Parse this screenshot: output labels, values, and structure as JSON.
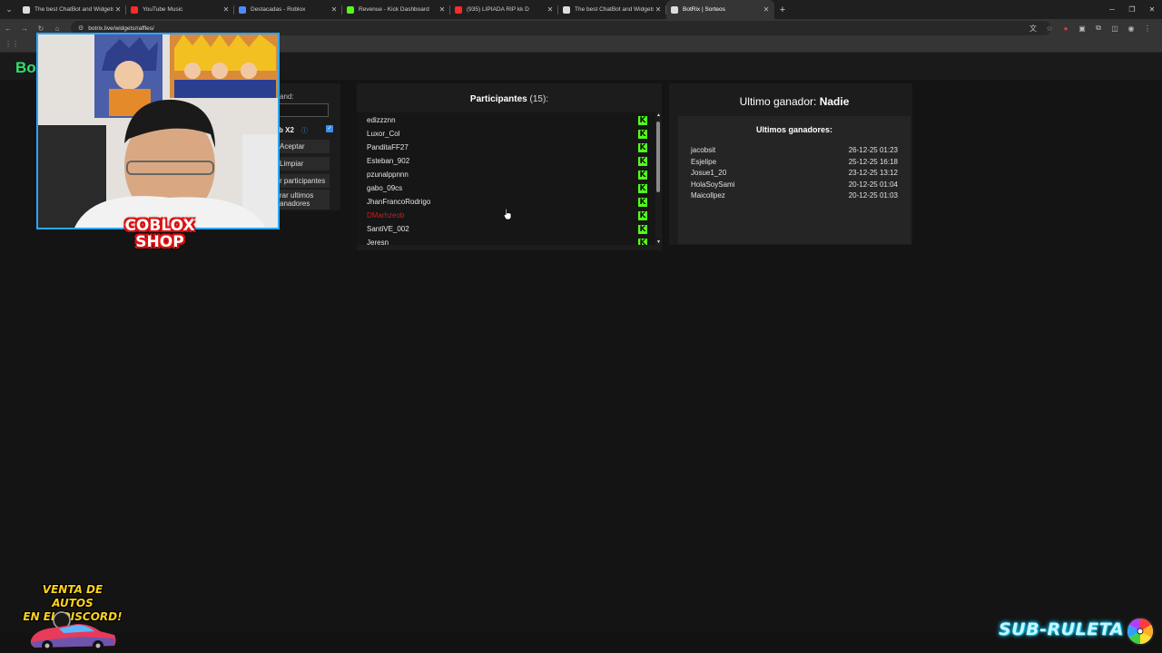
{
  "browser": {
    "tabs": [
      {
        "title": "The best ChatBot and Widgets",
        "fav_color": "#dddddd",
        "active": false
      },
      {
        "title": "YouTube Music",
        "fav_color": "#ff2a2a",
        "active": false
      },
      {
        "title": "Destacadas - Roblox",
        "fav_color": "#4a8cff",
        "active": false
      },
      {
        "title": "Revenue - Kick Dashboard",
        "fav_color": "#53fc18",
        "active": false
      },
      {
        "title": "(935) LIPIADA RIP kk D",
        "fav_color": "#ff2a2a",
        "active": false
      },
      {
        "title": "The best ChatBot and Widgets",
        "fav_color": "#dddddd",
        "active": false
      },
      {
        "title": "BotRix | Sorteos",
        "fav_color": "#dddddd",
        "active": true
      }
    ],
    "url": "botrix.live/widgets/raffles/"
  },
  "page": {
    "brand": "Bot",
    "left_panel": {
      "label_partial": "and:",
      "x2_label": "b X2",
      "accept_button": "Aceptar",
      "clear_button": "Limpiar",
      "participants_button": "r participantes",
      "last_winners_button_line1": "rar ultimos",
      "last_winners_button_line2": "anadores"
    },
    "participants": {
      "title": "Participantes",
      "count": "(15):",
      "rows": [
        {
          "name": "edizzznn",
          "red": false
        },
        {
          "name": "Luxor_Col",
          "red": false
        },
        {
          "name": "PanditaFF27",
          "red": false
        },
        {
          "name": "Esteban_902",
          "red": false
        },
        {
          "name": "pzunalppnnn",
          "red": false
        },
        {
          "name": "gabo_09cs",
          "red": false
        },
        {
          "name": "JhanFrancoRodrigo",
          "red": false
        },
        {
          "name": "DMarhzeob",
          "red": true
        },
        {
          "name": "SantiVE_002",
          "red": false
        },
        {
          "name": "Jeresn",
          "red": false
        }
      ]
    },
    "winner": {
      "title_prefix": "Ultimo ganador:",
      "title_value": "Nadie",
      "list_heading": "Ultimos ganadores:",
      "rows": [
        {
          "name": "jacobsit",
          "date": "26-12-25 01:23"
        },
        {
          "name": "Esjelipe",
          "date": "25-12-25 16:18"
        },
        {
          "name": "Josue1_20",
          "date": "23-12-25 13:12"
        },
        {
          "name": "HolaSoySami",
          "date": "20-12-25 01:04"
        },
        {
          "name": "Maicollpez",
          "date": "20-12-25 01:03"
        }
      ]
    }
  },
  "overlays": {
    "coblox_line1": "COBLOX",
    "coblox_line2": "SHOP",
    "venta_line1": "VENTA DE AUTOS",
    "venta_line2": "EN EL DISCORD!",
    "sub_ruleta": "SUB-RULETA"
  }
}
